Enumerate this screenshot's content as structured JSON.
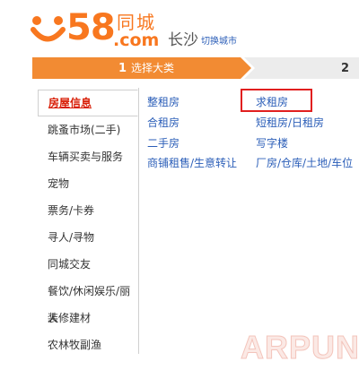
{
  "header": {
    "logo": {
      "number": "58",
      "brand": "同城",
      "domain": ".com"
    },
    "city": "长沙",
    "switch_city": "切换城市",
    "brand_color": "#f8771f"
  },
  "steps": [
    {
      "number": "1",
      "label": "选择大类",
      "state": "active"
    },
    {
      "number": "2",
      "label": "",
      "state": "pending"
    }
  ],
  "categories": [
    {
      "label": "房屋信息",
      "active": true
    },
    {
      "label": "跳蚤市场(二手)"
    },
    {
      "label": "车辆买卖与服务"
    },
    {
      "label": "宠物"
    },
    {
      "label": "票务/卡券"
    },
    {
      "label": "寻人/寻物"
    },
    {
      "label": "同城交友"
    },
    {
      "label": "餐饮/休闲娱乐/丽人"
    },
    {
      "label": "装修建材"
    },
    {
      "label": "农林牧副渔"
    }
  ],
  "subcategories": [
    {
      "label": "整租房"
    },
    {
      "label": "求租房",
      "selected": true
    },
    {
      "label": "合租房"
    },
    {
      "label": "短租房/日租房"
    },
    {
      "label": "二手房"
    },
    {
      "label": "写字楼"
    },
    {
      "label": "商铺租售/生意转让"
    },
    {
      "label": "厂房/仓库/土地/车位"
    }
  ],
  "watermark": "ARPUN",
  "colors": {
    "step_active": "#f28b33",
    "step_pending": "#ececec",
    "link": "#2b5eb8",
    "active_category": "#d81e06",
    "selection_box": "#e11f1f"
  }
}
